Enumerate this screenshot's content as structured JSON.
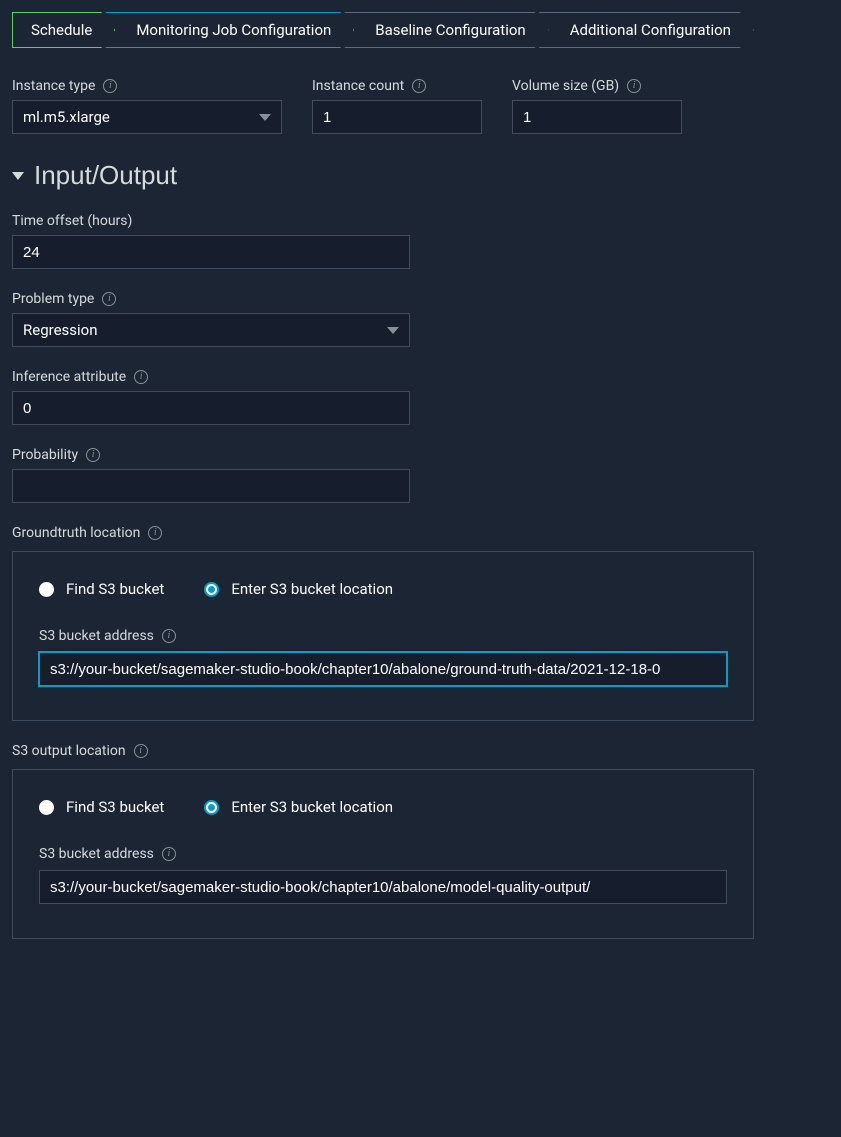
{
  "steps": {
    "s1": "Schedule",
    "s2": "Monitoring Job Configuration",
    "s3": "Baseline Configuration",
    "s4": "Additional Configuration"
  },
  "labels": {
    "instance_type": "Instance type",
    "instance_count": "Instance count",
    "volume_size": "Volume size (GB)",
    "time_offset": "Time offset (hours)",
    "problem_type": "Problem type",
    "inference_attribute": "Inference attribute",
    "probability": "Probability",
    "groundtruth_location": "Groundtruth location",
    "s3_output_location": "S3 output location",
    "s3_bucket_address": "S3 bucket address",
    "find_s3": "Find S3 bucket",
    "enter_s3": "Enter S3 bucket location"
  },
  "section": {
    "io_title": "Input/Output"
  },
  "values": {
    "instance_type": "ml.m5.xlarge",
    "instance_count": "1",
    "volume_size": "1",
    "time_offset": "24",
    "problem_type": "Regression",
    "inference_attribute": "0",
    "probability": "",
    "groundtruth_s3": "s3://your-bucket/sagemaker-studio-book/chapter10/abalone/ground-truth-data/2021-12-18-0",
    "output_s3": "s3://your-bucket/sagemaker-studio-book/chapter10/abalone/model-quality-output/"
  },
  "icons": {
    "info": "i"
  }
}
